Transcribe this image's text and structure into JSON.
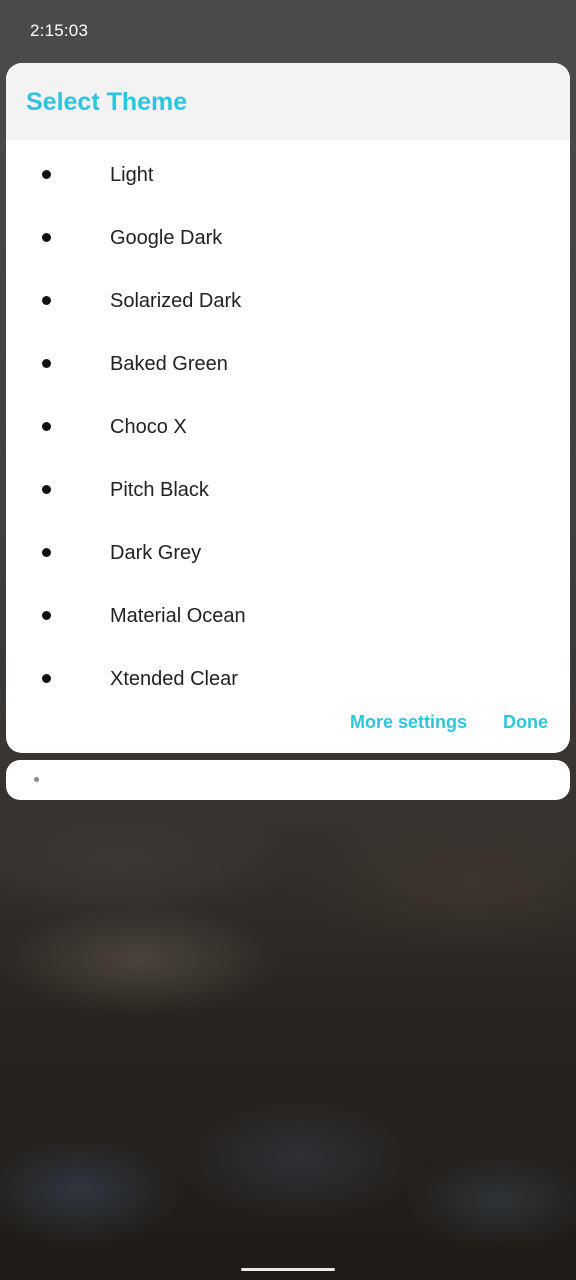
{
  "status_bar": {
    "time": "2:15:03"
  },
  "dialog": {
    "title": "Select Theme",
    "themes": [
      {
        "label": "Light"
      },
      {
        "label": "Google Dark"
      },
      {
        "label": "Solarized Dark"
      },
      {
        "label": "Baked Green"
      },
      {
        "label": "Choco X"
      },
      {
        "label": "Pitch Black"
      },
      {
        "label": "Dark Grey"
      },
      {
        "label": "Material Ocean"
      },
      {
        "label": "Xtended Clear"
      }
    ],
    "more_settings_label": "More settings",
    "done_label": "Done"
  },
  "colors": {
    "accent": "#2fc4de",
    "dialog_header_bg": "#f3f3f3",
    "dialog_bg": "#ffffff"
  },
  "icons": {
    "list_bullet": "bullet-icon",
    "secondary_card_dot": "dot-icon"
  }
}
